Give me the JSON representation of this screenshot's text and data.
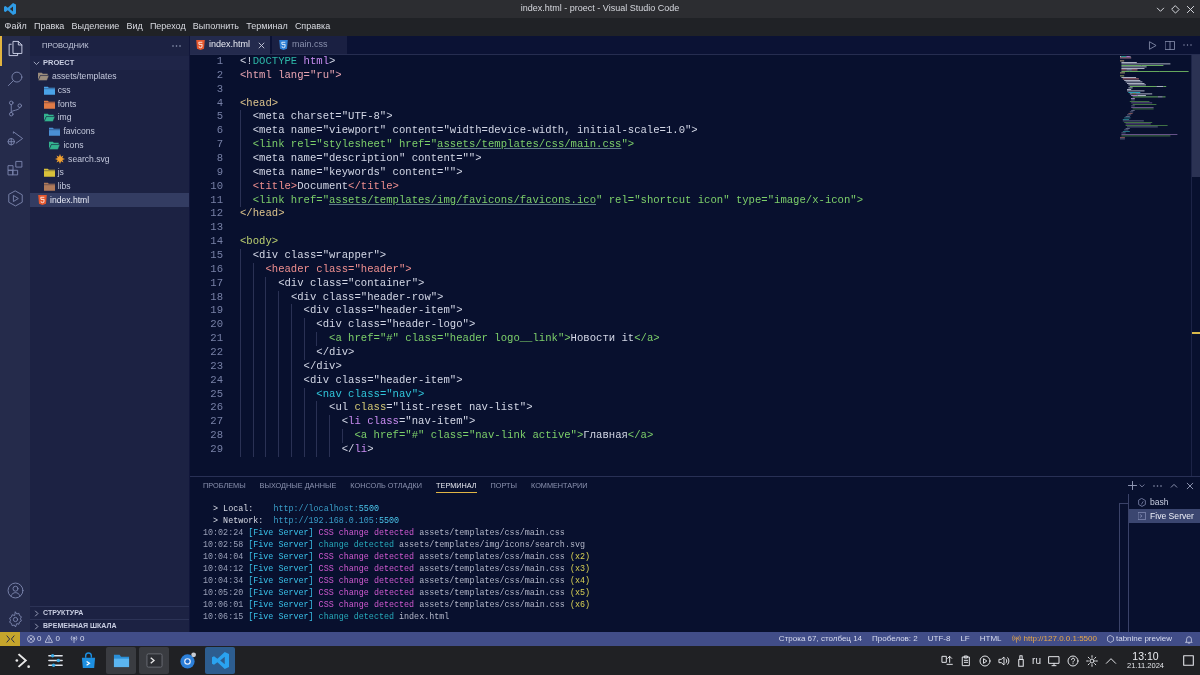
{
  "window": {
    "title": "index.html - proect - Visual Studio Code"
  },
  "menu": [
    "Файл",
    "Правка",
    "Выделение",
    "Вид",
    "Переход",
    "Выполнить",
    "Терминал",
    "Справка"
  ],
  "activity_bar": {
    "items": [
      {
        "selected": true
      },
      {
        "selected": false
      },
      {
        "selected": false
      },
      {
        "selected": false
      },
      {
        "selected": false
      },
      {
        "selected": false
      }
    ]
  },
  "sidebar": {
    "title": "ПРОВОДНИК",
    "folder": {
      "label": "PROECT",
      "expanded": true
    },
    "tree": [
      {
        "label": "assets/templates",
        "kind": "folder",
        "expanded": true,
        "selected": false,
        "color": "#9a8c7c",
        "children": [
          {
            "label": "css",
            "kind": "folder",
            "expanded": false,
            "selected": false,
            "color": "#4aa3e8"
          },
          {
            "label": "fonts",
            "kind": "folder",
            "expanded": false,
            "selected": false,
            "color": "#e07b46"
          },
          {
            "label": "img",
            "kind": "folder",
            "expanded": true,
            "selected": false,
            "color": "#33b38f",
            "children": [
              {
                "label": "favicons",
                "kind": "folder",
                "expanded": false,
                "selected": false,
                "color": "#4a8fd4"
              },
              {
                "label": "icons",
                "kind": "folder",
                "expanded": true,
                "selected": false,
                "color": "#33b38f",
                "children": [
                  {
                    "label": "search.svg",
                    "kind": "image",
                    "selected": false,
                    "color": "#f0a030"
                  }
                ]
              }
            ]
          },
          {
            "label": "js",
            "kind": "folder",
            "expanded": false,
            "selected": false,
            "color": "#d9c13a"
          },
          {
            "label": "libs",
            "kind": "folder",
            "expanded": false,
            "selected": false,
            "color": "#b07a5a"
          }
        ]
      },
      {
        "label": "index.html",
        "kind": "html",
        "selected": true,
        "color": "#e4572e"
      }
    ],
    "sections": [
      {
        "label": "СТРУКТУРА",
        "expanded": false
      },
      {
        "label": "ВРЕМЕННАЯ ШКАЛА",
        "expanded": false
      }
    ]
  },
  "editor": {
    "tabs": [
      {
        "label": "index.html",
        "kind": "html",
        "selected": true
      },
      {
        "label": "main.css",
        "kind": "css",
        "selected": false
      }
    ],
    "lines": [
      {
        "number": "1",
        "segments": [
          {
            "text": "<!",
            "kind": "plain"
          },
          {
            "text": "DOCTYPE",
            "kind": "keyword"
          },
          {
            "text": " html",
            "kind": "name"
          },
          {
            "text": ">",
            "kind": "plain"
          }
        ]
      },
      {
        "number": "2",
        "segments": [
          {
            "text": "<html lang=\"ru\">",
            "kind": "element"
          }
        ]
      },
      {
        "number": "3"
      },
      {
        "number": "4",
        "segments": [
          {
            "text": "<head>",
            "kind": "head"
          }
        ]
      },
      {
        "number": "5",
        "segments": [
          {
            "text": "  <meta charset=\"UTF-8\">",
            "kind": "plain"
          }
        ]
      },
      {
        "number": "6",
        "segments": [
          {
            "text": "  <meta name=\"viewport\" content=\"width=device-width, initial-scale=1.0\">",
            "kind": "plain"
          }
        ]
      },
      {
        "number": "7",
        "segments": [
          {
            "text": "  <link rel=\"stylesheet\" href=\"",
            "kind": "anchor"
          },
          {
            "text": "assets/templates/css/main.css",
            "kind": "anchor",
            "link": true
          },
          {
            "text": "\">",
            "kind": "anchor"
          }
        ]
      },
      {
        "number": "8",
        "segments": [
          {
            "text": "  <meta name=\"description\" content=\"\">",
            "kind": "plain"
          }
        ]
      },
      {
        "number": "9",
        "segments": [
          {
            "text": "  <meta name=\"keywords\" content=\"\">",
            "kind": "plain"
          }
        ]
      },
      {
        "number": "10",
        "segments": [
          {
            "text": "  <title>",
            "kind": "heading"
          },
          {
            "text": "Document",
            "kind": "plain"
          },
          {
            "text": "</title>",
            "kind": "heading"
          }
        ]
      },
      {
        "number": "11",
        "segments": [
          {
            "text": "  <link href=\"",
            "kind": "anchor"
          },
          {
            "text": "assets/templates/img/favicons/favicons.ico",
            "kind": "anchor",
            "link": true
          },
          {
            "text": "\" rel=\"shortcut icon\" type=\"image/x-icon\">",
            "kind": "anchor"
          }
        ]
      },
      {
        "number": "12",
        "segments": [
          {
            "text": "</head>",
            "kind": "head"
          }
        ]
      },
      {
        "number": "13"
      },
      {
        "number": "14",
        "segments": [
          {
            "text": "<body>",
            "kind": "body"
          }
        ]
      },
      {
        "number": "15",
        "segments": [
          {
            "text": "  <div class=\"wrapper\">",
            "kind": "plain"
          }
        ]
      },
      {
        "number": "16",
        "segments": [
          {
            "text": "    <header class=\"header\">",
            "kind": "heading"
          }
        ]
      },
      {
        "number": "17",
        "segments": [
          {
            "text": "      <div class=\"container\">",
            "kind": "plain"
          }
        ]
      },
      {
        "number": "18",
        "segments": [
          {
            "text": "        <div class=\"header-row\">",
            "kind": "plain"
          }
        ]
      },
      {
        "number": "19",
        "segments": [
          {
            "text": "          <div class=\"header-item\">",
            "kind": "plain"
          }
        ]
      },
      {
        "number": "20",
        "segments": [
          {
            "text": "            <div class=\"header-logo\">",
            "kind": "plain"
          }
        ]
      },
      {
        "number": "21",
        "segments": [
          {
            "text": "              <a href=\"#\" class=\"header logo__link\">",
            "kind": "anchor"
          },
          {
            "text": "Новости it",
            "kind": "plain"
          },
          {
            "text": "</a>",
            "kind": "anchor"
          }
        ]
      },
      {
        "number": "22",
        "segments": [
          {
            "text": "            </div>",
            "kind": "plain"
          }
        ]
      },
      {
        "number": "23",
        "segments": [
          {
            "text": "          </div>",
            "kind": "plain"
          }
        ]
      },
      {
        "number": "24",
        "segments": [
          {
            "text": "          <div class=\"header-item\">",
            "kind": "plain"
          }
        ]
      },
      {
        "number": "25",
        "segments": [
          {
            "text": "            <nav class=\"nav\">",
            "kind": "nav"
          }
        ]
      },
      {
        "number": "26",
        "segments": [
          {
            "text": "              <ul ",
            "kind": "plain"
          },
          {
            "text": "class",
            "kind": "attribute"
          },
          {
            "text": "=\"list-reset nav-list\">",
            "kind": "plain"
          }
        ]
      },
      {
        "number": "27",
        "segments": [
          {
            "text": "                <",
            "kind": "plain"
          },
          {
            "text": "li class",
            "kind": "name"
          },
          {
            "text": "=\"nav-item\">",
            "kind": "plain"
          }
        ]
      },
      {
        "number": "28",
        "segments": [
          {
            "text": "                  <a href=\"#\" class=\"nav-link active\">",
            "kind": "anchor"
          },
          {
            "text": "Главная",
            "kind": "plain"
          },
          {
            "text": "</a>",
            "kind": "anchor"
          }
        ]
      },
      {
        "number": "29",
        "segments": [
          {
            "text": "                </",
            "kind": "plain"
          },
          {
            "text": "li",
            "kind": "name"
          },
          {
            "text": ">",
            "kind": "plain"
          }
        ]
      }
    ]
  },
  "panel": {
    "tabs": [
      {
        "label": "ПРОБЛЕМЫ",
        "selected": false
      },
      {
        "label": "ВЫХОДНЫЕ ДАННЫЕ",
        "selected": false
      },
      {
        "label": "КОНСОЛЬ ОТЛАДКИ",
        "selected": false
      },
      {
        "label": "ТЕРМИНАЛ",
        "selected": true
      },
      {
        "label": "ПОРТЫ",
        "selected": false
      },
      {
        "label": "КОММЕНТАРИИ",
        "selected": false
      }
    ],
    "terminal": [
      {
        "segments": [
          {
            "text": "  > Local:    ",
            "kind": "prompt"
          },
          {
            "text": "http://localhost:",
            "kind": "url"
          },
          {
            "text": "5500",
            "kind": "port"
          }
        ]
      },
      {
        "segments": [
          {
            "text": "  > Network:  ",
            "kind": "prompt"
          },
          {
            "text": "http://192.168.0.105:",
            "kind": "url"
          },
          {
            "text": "5500",
            "kind": "port"
          }
        ]
      },
      {
        "segments": [
          {
            "text": "10:02:24 ",
            "kind": "time"
          },
          {
            "text": "[Five Server]",
            "kind": "source"
          },
          {
            "text": " CSS change detected",
            "kind": "style"
          },
          {
            "text": " assets/templates/css/main.css",
            "kind": "path"
          }
        ]
      },
      {
        "segments": [
          {
            "text": "10:02:58 ",
            "kind": "time"
          },
          {
            "text": "[Five Server]",
            "kind": "source"
          },
          {
            "text": " change detected",
            "kind": "change"
          },
          {
            "text": " assets/templates/img/icons/search.svg",
            "kind": "path"
          }
        ]
      },
      {
        "segments": [
          {
            "text": "10:04:04 ",
            "kind": "time"
          },
          {
            "text": "[Five Server]",
            "kind": "source"
          },
          {
            "text": " CSS change detected",
            "kind": "style"
          },
          {
            "text": " assets/templates/css/main.css",
            "kind": "path"
          },
          {
            "text": " (x2)",
            "kind": "count"
          }
        ]
      },
      {
        "segments": [
          {
            "text": "10:04:12 ",
            "kind": "time"
          },
          {
            "text": "[Five Server]",
            "kind": "source"
          },
          {
            "text": " CSS change detected",
            "kind": "style"
          },
          {
            "text": " assets/templates/css/main.css",
            "kind": "path"
          },
          {
            "text": " (x3)",
            "kind": "count"
          }
        ]
      },
      {
        "segments": [
          {
            "text": "10:04:34 ",
            "kind": "time"
          },
          {
            "text": "[Five Server]",
            "kind": "source"
          },
          {
            "text": " CSS change detected",
            "kind": "style"
          },
          {
            "text": " assets/templates/css/main.css",
            "kind": "path"
          },
          {
            "text": " (x4)",
            "kind": "count"
          }
        ]
      },
      {
        "segments": [
          {
            "text": "10:05:20 ",
            "kind": "time"
          },
          {
            "text": "[Five Server]",
            "kind": "source"
          },
          {
            "text": " CSS change detected",
            "kind": "style"
          },
          {
            "text": " assets/templates/css/main.css",
            "kind": "path"
          },
          {
            "text": " (x5)",
            "kind": "count"
          }
        ]
      },
      {
        "segments": [
          {
            "text": "10:06:01 ",
            "kind": "time"
          },
          {
            "text": "[Five Server]",
            "kind": "source"
          },
          {
            "text": " CSS change detected",
            "kind": "style"
          },
          {
            "text": " assets/templates/css/main.css",
            "kind": "path"
          },
          {
            "text": " (x6)",
            "kind": "count"
          }
        ]
      },
      {
        "segments": [
          {
            "text": "10:06:15 ",
            "kind": "time"
          },
          {
            "text": "[Five Server]",
            "kind": "source"
          },
          {
            "text": " change detected",
            "kind": "change"
          },
          {
            "text": " index.html",
            "kind": "path"
          }
        ]
      }
    ],
    "sessions": [
      {
        "label": "bash",
        "kind": "shell",
        "selected": false
      },
      {
        "label": "Five Server",
        "kind": "task",
        "selected": true
      }
    ]
  },
  "status_bar": {
    "errors": "0",
    "warnings": "0",
    "ports": "0",
    "items": [
      "Строка 67, столбец 14",
      "Пробелов: 2",
      "UTF-8",
      "LF",
      "HTML"
    ],
    "live_server": "http://127.0.0.1:5500",
    "tabnine": "tabnine preview"
  },
  "taskbar": {
    "apps": [
      {
        "open": false,
        "selected": false
      },
      {
        "open": false,
        "selected": false
      },
      {
        "open": false,
        "selected": false
      },
      {
        "open": true,
        "selected": false
      },
      {
        "open": true,
        "selected": false
      },
      {
        "open": false,
        "selected": false
      },
      {
        "selected": true
      }
    ],
    "keyboard_layout": "ru",
    "clock": {
      "time": "13:10",
      "date": "21.11.2024"
    }
  }
}
